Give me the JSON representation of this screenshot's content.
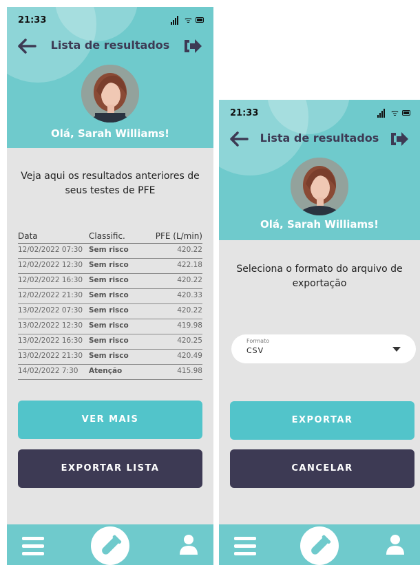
{
  "status": {
    "time": "21:33"
  },
  "header": {
    "title": "Lista de resultados",
    "greeting": "Olá, Sarah Williams!"
  },
  "results": {
    "intro": "Veja aqui os resultados anteriores de seus testes de PFE",
    "columns": [
      "Data",
      "Classific.",
      "PFE (L/min)"
    ],
    "rows": [
      {
        "date": "12/02/2022 07:30",
        "class": "Sem risco",
        "pfe": "420.22"
      },
      {
        "date": "12/02/2022 12:30",
        "class": "Sem risco",
        "pfe": "422.18"
      },
      {
        "date": "12/02/2022 16:30",
        "class": "Sem risco",
        "pfe": "420.22"
      },
      {
        "date": "12/02/2022 21:30",
        "class": "Sem risco",
        "pfe": "420.33"
      },
      {
        "date": "13/02/2022 07:30",
        "class": "Sem risco",
        "pfe": "420.22"
      },
      {
        "date": "13/02/2022 12:30",
        "class": "Sem risco",
        "pfe": "419.98"
      },
      {
        "date": "13/02/2022 16:30",
        "class": "Sem risco",
        "pfe": "420.25"
      },
      {
        "date": "13/02/2022 21:30",
        "class": "Sem risco",
        "pfe": "420.49"
      },
      {
        "date": "14/02/2022 7:30",
        "class": "Atenção",
        "pfe": "415.98"
      }
    ],
    "see_more_label": "VER MAIS",
    "export_list_label": "EXPORTAR LISTA"
  },
  "export": {
    "prompt": "Seleciona o formato do arquivo de exportação",
    "format_label": "Formato",
    "format_value": "CSV",
    "export_label": "EXPORTAR",
    "cancel_label": "CANCELAR"
  },
  "icons": {
    "back": "arrow-left-icon",
    "logout": "logout-icon",
    "menu": "menu-icon",
    "test": "test-tube-icon",
    "user": "user-icon",
    "dropdown": "chevron-down-icon"
  },
  "colors": {
    "primary": "#6fcacc",
    "button_teal": "#52c4ca",
    "button_dark": "#3d3a54",
    "background": "#e4e4e4",
    "title": "#3d3a54"
  }
}
